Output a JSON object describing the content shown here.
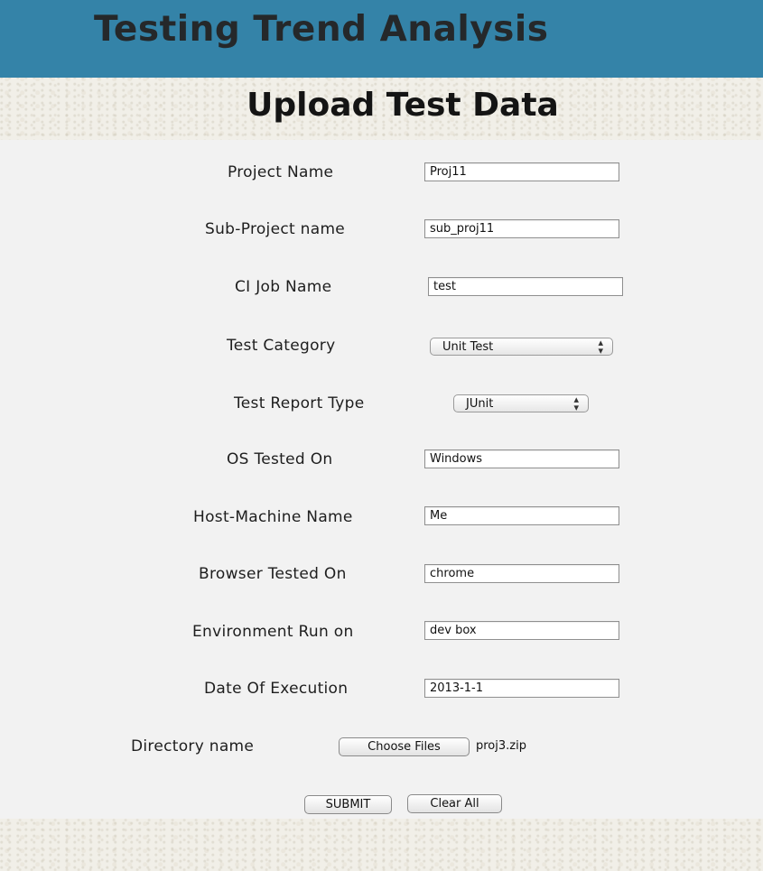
{
  "header": {
    "title": "Testing Trend Analysis"
  },
  "page": {
    "heading": "Upload Test Data"
  },
  "form": {
    "project_name": {
      "label": "Project Name",
      "value": "Proj11"
    },
    "sub_project_name": {
      "label": "Sub-Project name",
      "value": "sub_proj11"
    },
    "ci_job_name": {
      "label": "CI Job Name",
      "value": "test"
    },
    "test_category": {
      "label": "Test Category",
      "value": "Unit Test"
    },
    "test_report_type": {
      "label": "Test Report Type",
      "value": "JUnit"
    },
    "os_tested_on": {
      "label": "OS Tested On",
      "value": "Windows"
    },
    "host_machine_name": {
      "label": "Host-Machine Name",
      "value": "Me"
    },
    "browser_tested_on": {
      "label": "Browser Tested On",
      "value": "chrome"
    },
    "environment_run_on": {
      "label": "Environment Run on",
      "value": "dev box"
    },
    "date_of_execution": {
      "label": "Date Of Execution",
      "value": "2013-1-1"
    },
    "directory_name": {
      "label": "Directory name",
      "button_label": "Choose Files",
      "file_name": "proj3.zip"
    }
  },
  "actions": {
    "submit_label": "SUBMIT",
    "clear_label": "Clear All"
  },
  "icons": {
    "select_arrows": "⬍"
  }
}
